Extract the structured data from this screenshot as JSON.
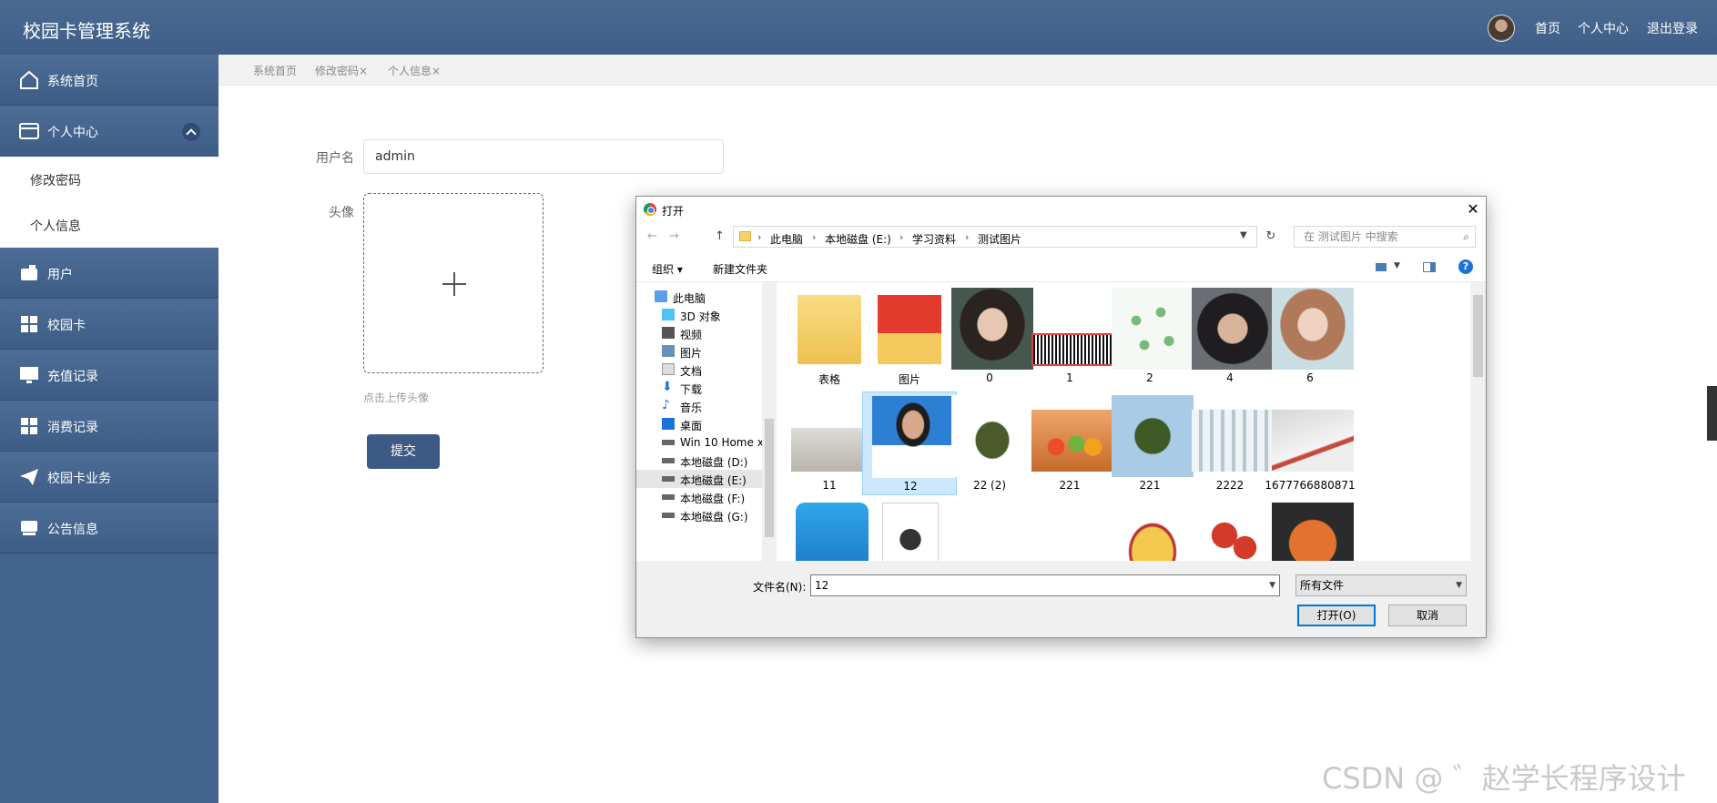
{
  "header": {
    "app_title": "校园卡管理系统",
    "links": [
      "首页",
      "个人中心",
      "退出登录"
    ]
  },
  "sidebar": {
    "items": [
      {
        "label": "系统首页",
        "icon": "home-icon"
      },
      {
        "label": "个人中心",
        "icon": "card-icon"
      },
      {
        "label": "修改密码"
      },
      {
        "label": "个人信息"
      },
      {
        "label": "用户",
        "icon": "wallet-icon"
      },
      {
        "label": "校园卡",
        "icon": "grid-icon"
      },
      {
        "label": "充值记录",
        "icon": "monitor-icon"
      },
      {
        "label": "消费记录",
        "icon": "grid-icon"
      },
      {
        "label": "校园卡业务",
        "icon": "paper-plane-icon"
      },
      {
        "label": "公告信息",
        "icon": "inbox-icon"
      }
    ]
  },
  "tabs": [
    "系统首页",
    "修改密码×",
    "个人信息×"
  ],
  "form": {
    "username_label": "用户名",
    "username_value": "admin",
    "avatar_label": "头像",
    "upload_hint": "点击上传头像",
    "submit_label": "提交"
  },
  "dialog": {
    "title": "打开",
    "close": "✕",
    "nav_back": "←",
    "nav_forward": "→",
    "nav_up": "↑",
    "breadcrumbs": [
      "此电脑",
      "本地磁盘 (E:)",
      "学习资料",
      "测试图片"
    ],
    "search_placeholder": "在 测试图片 中搜索",
    "toolbar": {
      "organize": "组织 ▾",
      "new_folder": "新建文件夹",
      "help": "?"
    },
    "tree": [
      {
        "label": "此电脑",
        "icon": "computer-icon"
      },
      {
        "label": "3D 对象",
        "icon": "cube-icon"
      },
      {
        "label": "视频",
        "icon": "video-icon"
      },
      {
        "label": "图片",
        "icon": "pictures-icon"
      },
      {
        "label": "文档",
        "icon": "documents-icon"
      },
      {
        "label": "下载",
        "icon": "download-icon"
      },
      {
        "label": "音乐",
        "icon": "music-icon"
      },
      {
        "label": "桌面",
        "icon": "desktop-icon"
      },
      {
        "label": "Win 10 Home x",
        "icon": "drive-icon"
      },
      {
        "label": "本地磁盘 (D:)",
        "icon": "drive-icon"
      },
      {
        "label": "本地磁盘 (E:)",
        "icon": "drive-icon"
      },
      {
        "label": "本地磁盘 (F:)",
        "icon": "drive-icon"
      },
      {
        "label": "本地磁盘 (G:)",
        "icon": "drive-icon"
      }
    ],
    "files": [
      {
        "name": "表格"
      },
      {
        "name": "图片"
      },
      {
        "name": "0"
      },
      {
        "name": "1"
      },
      {
        "name": "2"
      },
      {
        "name": "4"
      },
      {
        "name": "6"
      },
      {
        "name": "11"
      },
      {
        "name": "12"
      },
      {
        "name": "22 (2)"
      },
      {
        "name": "221"
      },
      {
        "name": "221"
      },
      {
        "name": "2222"
      },
      {
        "name": "1677766880871"
      },
      {
        "name": ""
      },
      {
        "name": ""
      },
      {
        "name": ""
      },
      {
        "name": ""
      },
      {
        "name": ""
      },
      {
        "name": ""
      },
      {
        "name": ""
      }
    ],
    "filename_label": "文件名(N):",
    "filename_value": "12",
    "filter_value": "所有文件",
    "open_label": "打开(O)",
    "cancel_label": "取消"
  },
  "watermark": "CSDN @ ゛赵学长程序设计",
  "colors": {
    "primary": "#42638c",
    "header": "#4b6a92",
    "selection": "#cce8ff"
  }
}
